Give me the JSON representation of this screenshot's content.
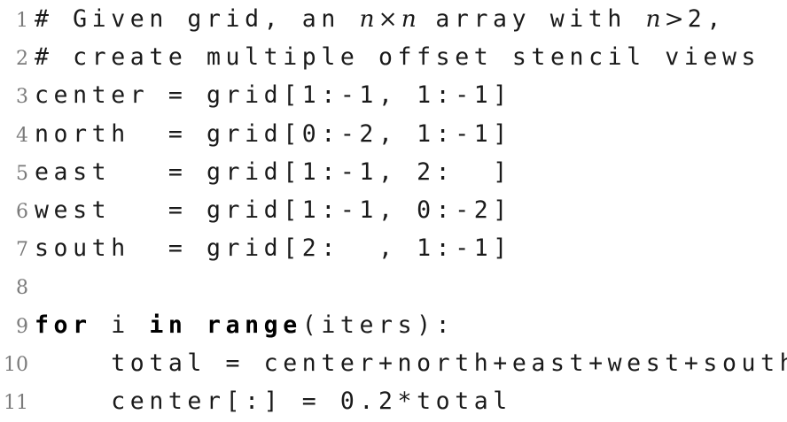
{
  "code": {
    "lines": [
      {
        "number": "1",
        "text": "# Given grid, an "
      },
      {
        "number": "2",
        "text": "# create multiple offset stencil views"
      },
      {
        "number": "3",
        "text": "center = grid[1:-1, 1:-1]"
      },
      {
        "number": "4",
        "text": "north  = grid[0:-2, 1:-1]"
      },
      {
        "number": "5",
        "text": "east   = grid[1:-1, 2:  ]"
      },
      {
        "number": "6",
        "text": "west   = grid[1:-1, 0:-2]"
      },
      {
        "number": "7",
        "text": "south  = grid[2:  , 1:-1]"
      },
      {
        "number": "8",
        "text": ""
      },
      {
        "number": "9",
        "text": ""
      },
      {
        "number": "10",
        "text": "    total = center+north+east+west+south"
      },
      {
        "number": "11",
        "text": "    center[:] = 0.2*total"
      }
    ],
    "line1_math": {
      "n1": "n",
      "times": "×",
      "n2": "n",
      "mid": " array with ",
      "n3": "n",
      "gt": ">",
      "tail": "2,"
    },
    "line9": {
      "kw_for": "for",
      "var": " i ",
      "kw_in": "in",
      "sp": " ",
      "kw_range": "range",
      "args": "(iters):"
    }
  }
}
